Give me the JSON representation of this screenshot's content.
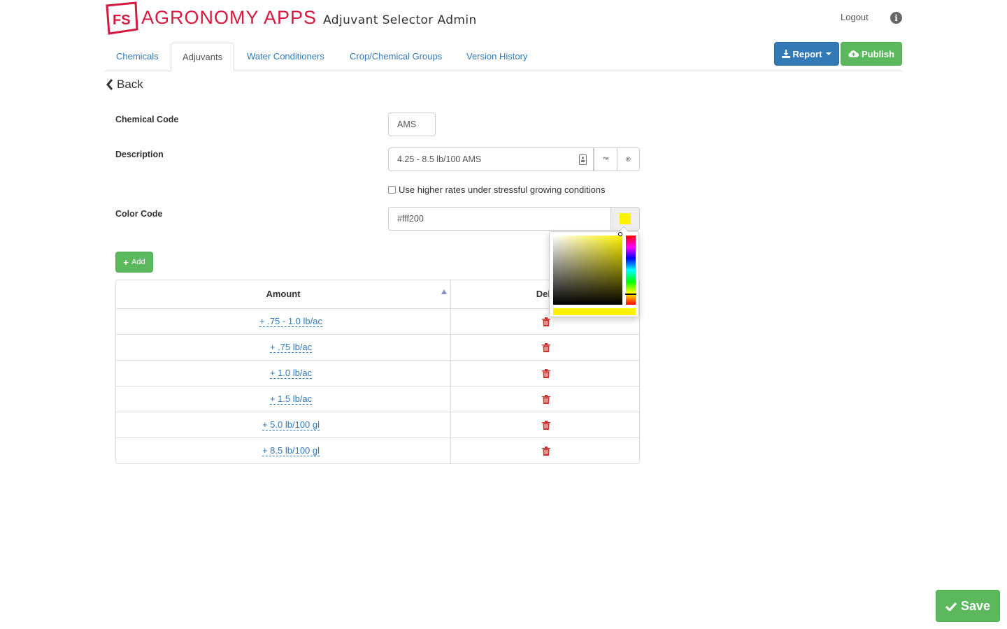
{
  "header": {
    "logo_text": "FS",
    "brand_name": "AGRONOMY APPS",
    "app_title": "Adjuvant Selector Admin",
    "logout": "Logout",
    "info_icon": "info-icon"
  },
  "tabs": [
    {
      "label": "Chemicals",
      "active": false
    },
    {
      "label": "Adjuvants",
      "active": true
    },
    {
      "label": "Water Conditioners",
      "active": false
    },
    {
      "label": "Crop/Chemical Groups",
      "active": false
    },
    {
      "label": "Version History",
      "active": false
    }
  ],
  "actions": {
    "report": "Report",
    "publish": "Publish"
  },
  "back_label": "Back",
  "form": {
    "chemical_code_label": "Chemical Code",
    "chemical_code_value": "AMS",
    "description_label": "Description",
    "description_value": "4.25 - 8.5 lb/100 AMS",
    "tm_symbol": "™",
    "reg_symbol": "®",
    "checkbox_label": "Use higher rates under stressful growing conditions",
    "checkbox_checked": false,
    "color_code_label": "Color Code",
    "color_code_value": "#fff200"
  },
  "add_label": "Add",
  "table": {
    "columns": [
      "Amount",
      "Dele"
    ],
    "sort_column": "Amount",
    "rows": [
      "+ .75 - 1.0 lb/ac",
      "+ .75 lb/ac",
      "+ 1.0 lb/ac",
      "+ 1.5 lb/ac",
      "+ 5.0 lb/100 gl",
      "+ 8.5 lb/100 gl"
    ]
  },
  "save_label": "Save",
  "colors": {
    "brand_red": "#d6193e",
    "primary": "#337ab7",
    "success": "#5cb85c",
    "danger": "#c9302c",
    "selected_color": "#fff200"
  }
}
